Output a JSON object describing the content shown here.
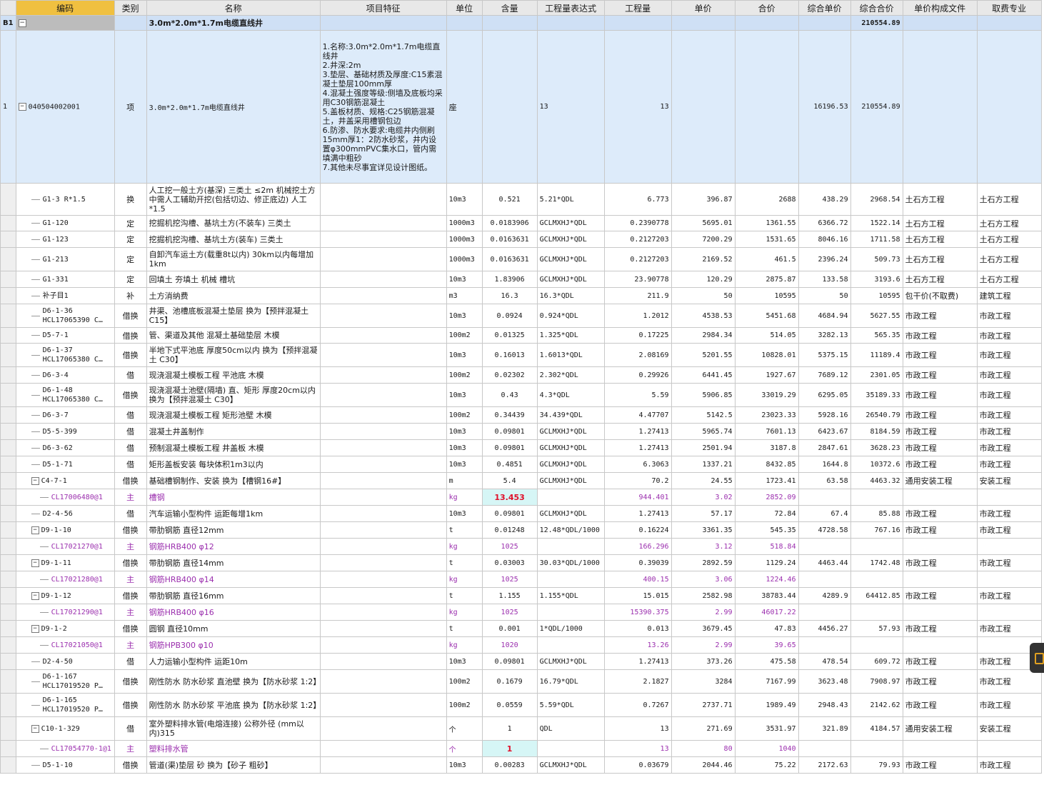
{
  "headers": [
    "编码",
    "类别",
    "名称",
    "项目特征",
    "单位",
    "含量",
    "工程量表达式",
    "工程量",
    "单价",
    "合价",
    "综合单价",
    "综合合价",
    "单价构成文件",
    "取费专业"
  ],
  "group": {
    "rownum": "B1",
    "name": "3.0m*2.0m*1.7m电缆直线井",
    "total": "210554.89"
  },
  "item": {
    "rownum": "1",
    "code": "040504002001",
    "type": "项",
    "name": "3.0m*2.0m*1.7m电缆直线井",
    "features": "1.名称:3.0m*2.0m*1.7m电缆直线井\n2.井深:2m\n3.垫层、基础材质及厚度:C15素混凝土垫层100mm厚\n4.混凝土强度等级:侧墙及底板均采用C30钢筋混凝土\n5.盖板材质、规格:C25钢筋混凝土，井盖采用槽钢包边\n6.防渗、防水要求:电缆井内侧刷15mm厚1：2防水砂浆，井内设置φ300mmPVC集水口，管内需填满中粗砂\n7.其他未尽事宜详见设计图纸。",
    "unit": "座",
    "expr": "13",
    "qty": "13",
    "unit_comp": "16196.53",
    "total_comp": "210554.89"
  },
  "rows": [
    {
      "kind": "sub",
      "code": "G1-3 R*1.5",
      "type": "换",
      "name": "人工挖一般土方(基深) 三类土 ≤2m  机械挖土方中需人工辅助开挖(包括切边、修正底边) 人工*1.5",
      "unit": "10m3",
      "content": "0.521",
      "expr": "5.21*QDL",
      "qty": "6.773",
      "price": "396.87",
      "amount": "2688",
      "cu": "438.29",
      "ct": "2968.54",
      "file": "土石方工程",
      "fee": "土石方工程",
      "h": 45
    },
    {
      "kind": "sub",
      "code": "G1-120",
      "type": "定",
      "name": "挖掘机挖沟槽、基坑土方(不装车) 三类土",
      "unit": "1000m3",
      "content": "0.0183906",
      "expr": "GCLMXHJ*QDL",
      "qty": "0.2390778",
      "price": "5695.01",
      "amount": "1361.55",
      "cu": "6366.72",
      "ct": "1522.14",
      "file": "土石方工程",
      "fee": "土石方工程",
      "h": 22
    },
    {
      "kind": "sub",
      "code": "G1-123",
      "type": "定",
      "name": "挖掘机挖沟槽、基坑土方(装车) 三类土",
      "unit": "1000m3",
      "content": "0.0163631",
      "expr": "GCLMXHJ*QDL",
      "qty": "0.2127203",
      "price": "7200.29",
      "amount": "1531.65",
      "cu": "8046.16",
      "ct": "1711.58",
      "file": "土石方工程",
      "fee": "土石方工程",
      "h": 23
    },
    {
      "kind": "sub",
      "code": "G1-213",
      "type": "定",
      "name": "自卸汽车运土方(载重8t以内) 30km以内每增加1km",
      "unit": "1000m3",
      "content": "0.0163631",
      "expr": "GCLMXHJ*QDL",
      "qty": "0.2127203",
      "price": "2169.52",
      "amount": "461.5",
      "cu": "2396.24",
      "ct": "509.73",
      "file": "土石方工程",
      "fee": "土石方工程",
      "h": 33
    },
    {
      "kind": "sub",
      "code": "G1-331",
      "type": "定",
      "name": "回填土 夯填土 机械 槽坑",
      "unit": "10m3",
      "content": "1.83906",
      "expr": "GCLMXHJ*QDL",
      "qty": "23.90778",
      "price": "120.29",
      "amount": "2875.87",
      "cu": "133.58",
      "ct": "3193.6",
      "file": "土石方工程",
      "fee": "土石方工程",
      "h": 23
    },
    {
      "kind": "sub",
      "code": "补子目1",
      "type": "补",
      "name": "土方消纳费",
      "unit": "m3",
      "content": "16.3",
      "expr": "16.3*QDL",
      "qty": "211.9",
      "price": "50",
      "amount": "10595",
      "cu": "50",
      "ct": "10595",
      "file": "包干价(不取费)",
      "fee": "建筑工程",
      "h": 23
    },
    {
      "kind": "sub",
      "code": "D6-1-36\nHCL17065390 C…",
      "type": "借换",
      "name": "井渠、池槽底板混凝土垫层  换为【预拌混凝土 C15】",
      "unit": "10m3",
      "content": "0.0924",
      "expr": "0.924*QDL",
      "qty": "1.2012",
      "price": "4538.53",
      "amount": "5451.68",
      "cu": "4684.94",
      "ct": "5627.55",
      "file": "市政工程",
      "fee": "市政工程",
      "h": 33
    },
    {
      "kind": "sub",
      "code": "D5-7-1",
      "type": "借换",
      "name": "管、渠道及其他 混凝土基础垫层 木模",
      "unit": "100m2",
      "content": "0.01325",
      "expr": "1.325*QDL",
      "qty": "0.17225",
      "price": "2984.34",
      "amount": "514.05",
      "cu": "3282.13",
      "ct": "565.35",
      "file": "市政工程",
      "fee": "市政工程",
      "h": 22
    },
    {
      "kind": "sub",
      "code": "D6-1-37\nHCL17065380 C…",
      "type": "借换",
      "name": "半地下式平池底 厚度50cm以内  换为【预拌混凝土 C30】",
      "unit": "10m3",
      "content": "0.16013",
      "expr": "1.6013*QDL",
      "qty": "2.08169",
      "price": "5201.55",
      "amount": "10828.01",
      "cu": "5375.15",
      "ct": "11189.4",
      "file": "市政工程",
      "fee": "市政工程",
      "h": 33
    },
    {
      "kind": "sub",
      "code": "D6-3-4",
      "type": "借",
      "name": "现浇混凝土模板工程 平池底 木模",
      "unit": "100m2",
      "content": "0.02302",
      "expr": "2.302*QDL",
      "qty": "0.29926",
      "price": "6441.45",
      "amount": "1927.67",
      "cu": "7689.12",
      "ct": "2301.05",
      "file": "市政工程",
      "fee": "市政工程",
      "h": 23
    },
    {
      "kind": "sub",
      "code": "D6-1-48\nHCL17065380 C…",
      "type": "借换",
      "name": "现浇混凝土池壁(隔墙) 直、矩形 厚度20cm以内  换为【预拌混凝土 C30】",
      "unit": "10m3",
      "content": "0.43",
      "expr": "4.3*QDL",
      "qty": "5.59",
      "price": "5906.85",
      "amount": "33019.29",
      "cu": "6295.05",
      "ct": "35189.33",
      "file": "市政工程",
      "fee": "市政工程",
      "h": 33
    },
    {
      "kind": "sub",
      "code": "D6-3-7",
      "type": "借",
      "name": "现浇混凝土模板工程 矩形池壁 木模",
      "unit": "100m2",
      "content": "0.34439",
      "expr": "34.439*QDL",
      "qty": "4.47707",
      "price": "5142.5",
      "amount": "23023.33",
      "cu": "5928.16",
      "ct": "26540.79",
      "file": "市政工程",
      "fee": "市政工程",
      "h": 23
    },
    {
      "kind": "sub",
      "code": "D5-5-399",
      "type": "借",
      "name": "混凝土井盖制作",
      "unit": "10m3",
      "content": "0.09801",
      "expr": "GCLMXHJ*QDL",
      "qty": "1.27413",
      "price": "5965.74",
      "amount": "7601.13",
      "cu": "6423.67",
      "ct": "8184.59",
      "file": "市政工程",
      "fee": "市政工程",
      "h": 23
    },
    {
      "kind": "sub",
      "code": "D6-3-62",
      "type": "借",
      "name": "预制混凝土模板工程 井盖板 木模",
      "unit": "10m3",
      "content": "0.09801",
      "expr": "GCLMXHJ*QDL",
      "qty": "1.27413",
      "price": "2501.94",
      "amount": "3187.8",
      "cu": "2847.61",
      "ct": "3628.23",
      "file": "市政工程",
      "fee": "市政工程",
      "h": 23
    },
    {
      "kind": "sub",
      "code": "D5-1-71",
      "type": "借",
      "name": "矩形盖板安装 每块体积1m3以内",
      "unit": "10m3",
      "content": "0.4851",
      "expr": "GCLMXHJ*QDL",
      "qty": "6.3063",
      "price": "1337.21",
      "amount": "8432.85",
      "cu": "1644.8",
      "ct": "10372.6",
      "file": "市政工程",
      "fee": "市政工程",
      "h": 23
    },
    {
      "kind": "parent",
      "code": "C4-7-1",
      "type": "借换",
      "name": "基础槽钢制作、安装  换为【槽钢16#】",
      "unit": "m",
      "content": "5.4",
      "expr": "GCLMXHJ*QDL",
      "qty": "70.2",
      "price": "24.55",
      "amount": "1723.41",
      "cu": "63.58",
      "ct": "4463.32",
      "file": "通用安装工程",
      "fee": "安装工程",
      "h": 23
    },
    {
      "kind": "mat",
      "code": "CL17006480@1",
      "type": "主",
      "name": "槽钢",
      "unit": "kg",
      "content": "13.453",
      "expr": "",
      "qty": "944.401",
      "price": "3.02",
      "amount": "2852.09",
      "cu": "",
      "ct": "",
      "file": "",
      "fee": "",
      "h": 23,
      "hl": true
    },
    {
      "kind": "sub",
      "code": "D2-4-56",
      "type": "借",
      "name": "汽车运输小型构件 运距每增1km",
      "unit": "10m3",
      "content": "0.09801",
      "expr": "GCLMXHJ*QDL",
      "qty": "1.27413",
      "price": "57.17",
      "amount": "72.84",
      "cu": "67.4",
      "ct": "85.88",
      "file": "市政工程",
      "fee": "市政工程",
      "h": 23
    },
    {
      "kind": "parent",
      "code": "D9-1-10",
      "type": "借换",
      "name": "带肋钢筋 直径12mm",
      "unit": "t",
      "content": "0.01248",
      "expr": "12.48*QDL/1000",
      "qty": "0.16224",
      "price": "3361.35",
      "amount": "545.35",
      "cu": "4728.58",
      "ct": "767.16",
      "file": "市政工程",
      "fee": "市政工程",
      "h": 23
    },
    {
      "kind": "mat",
      "code": "CL17021270@1",
      "type": "主",
      "name": "钢筋HRB400 φ12",
      "unit": "kg",
      "content": "1025",
      "expr": "",
      "qty": "166.296",
      "price": "3.12",
      "amount": "518.84",
      "cu": "",
      "ct": "",
      "file": "",
      "fee": "",
      "h": 23
    },
    {
      "kind": "parent",
      "code": "D9-1-11",
      "type": "借换",
      "name": "带肋钢筋 直径14mm",
      "unit": "t",
      "content": "0.03003",
      "expr": "30.03*QDL/1000",
      "qty": "0.39039",
      "price": "2892.59",
      "amount": "1129.24",
      "cu": "4463.44",
      "ct": "1742.48",
      "file": "市政工程",
      "fee": "市政工程",
      "h": 23
    },
    {
      "kind": "mat",
      "code": "CL17021280@1",
      "type": "主",
      "name": "钢筋HRB400 φ14",
      "unit": "kg",
      "content": "1025",
      "expr": "",
      "qty": "400.15",
      "price": "3.06",
      "amount": "1224.46",
      "cu": "",
      "ct": "",
      "file": "",
      "fee": "",
      "h": 23
    },
    {
      "kind": "parent",
      "code": "D9-1-12",
      "type": "借换",
      "name": "带肋钢筋 直径16mm",
      "unit": "t",
      "content": "1.155",
      "expr": "1.155*QDL",
      "qty": "15.015",
      "price": "2582.98",
      "amount": "38783.44",
      "cu": "4289.9",
      "ct": "64412.85",
      "file": "市政工程",
      "fee": "市政工程",
      "h": 23
    },
    {
      "kind": "mat",
      "code": "CL17021290@1",
      "type": "主",
      "name": "钢筋HRB400 φ16",
      "unit": "kg",
      "content": "1025",
      "expr": "",
      "qty": "15390.375",
      "price": "2.99",
      "amount": "46017.22",
      "cu": "",
      "ct": "",
      "file": "",
      "fee": "",
      "h": 23
    },
    {
      "kind": "parent",
      "code": "D9-1-2",
      "type": "借换",
      "name": "圆钢 直径10mm",
      "unit": "t",
      "content": "0.001",
      "expr": "1*QDL/1000",
      "qty": "0.013",
      "price": "3679.45",
      "amount": "47.83",
      "cu": "4456.27",
      "ct": "57.93",
      "file": "市政工程",
      "fee": "市政工程",
      "h": 23
    },
    {
      "kind": "mat",
      "code": "CL17021050@1",
      "type": "主",
      "name": "钢筋HPB300 φ10",
      "unit": "kg",
      "content": "1020",
      "expr": "",
      "qty": "13.26",
      "price": "2.99",
      "amount": "39.65",
      "cu": "",
      "ct": "",
      "file": "",
      "fee": "",
      "h": 23
    },
    {
      "kind": "sub",
      "code": "D2-4-50",
      "type": "借",
      "name": "人力运输小型构件 运距10m",
      "unit": "10m3",
      "content": "0.09801",
      "expr": "GCLMXHJ*QDL",
      "qty": "1.27413",
      "price": "373.26",
      "amount": "475.58",
      "cu": "478.54",
      "ct": "609.72",
      "file": "市政工程",
      "fee": "市政工程",
      "h": 23
    },
    {
      "kind": "sub",
      "code": "D6-1-167\nHCL17019520 P…",
      "type": "借换",
      "name": "刚性防水 防水砂浆 直池壁  换为【防水砂浆 1:2】",
      "unit": "100m2",
      "content": "0.1679",
      "expr": "16.79*QDL",
      "qty": "2.1827",
      "price": "3284",
      "amount": "7167.99",
      "cu": "3623.48",
      "ct": "7908.97",
      "file": "市政工程",
      "fee": "市政工程",
      "h": 33
    },
    {
      "kind": "sub",
      "code": "D6-1-165\nHCL17019520 P…",
      "type": "借换",
      "name": "刚性防水 防水砂浆 平池底  换为【防水砂浆 1:2】",
      "unit": "100m2",
      "content": "0.0559",
      "expr": "5.59*QDL",
      "qty": "0.7267",
      "price": "2737.71",
      "amount": "1989.49",
      "cu": "2948.43",
      "ct": "2142.62",
      "file": "市政工程",
      "fee": "市政工程",
      "h": 33
    },
    {
      "kind": "parent",
      "code": "C10-1-329",
      "type": "借",
      "name": "室外塑料排水管(电熔连接) 公称外径 (mm以内)315",
      "unit": "个",
      "content": "1",
      "expr": "QDL",
      "qty": "13",
      "price": "271.69",
      "amount": "3531.97",
      "cu": "321.89",
      "ct": "4184.57",
      "file": "通用安装工程",
      "fee": "安装工程",
      "h": 33
    },
    {
      "kind": "mat",
      "code": "CL17054770-1@1",
      "type": "主",
      "name": "塑料排水管",
      "unit": "个",
      "content": "1",
      "expr": "",
      "qty": "13",
      "price": "80",
      "amount": "1040",
      "cu": "",
      "ct": "",
      "file": "",
      "fee": "",
      "h": 23,
      "hl": true
    },
    {
      "kind": "sub",
      "code": "D5-1-10",
      "type": "借换",
      "name": "管道(渠)垫层 砂  换为【砂子 粗砂】",
      "unit": "10m3",
      "content": "0.00283",
      "expr": "GCLMXHJ*QDL",
      "qty": "0.03679",
      "price": "2044.46",
      "amount": "75.22",
      "cu": "2172.63",
      "ct": "79.93",
      "file": "市政工程",
      "fee": "市政工程",
      "h": 23
    }
  ]
}
